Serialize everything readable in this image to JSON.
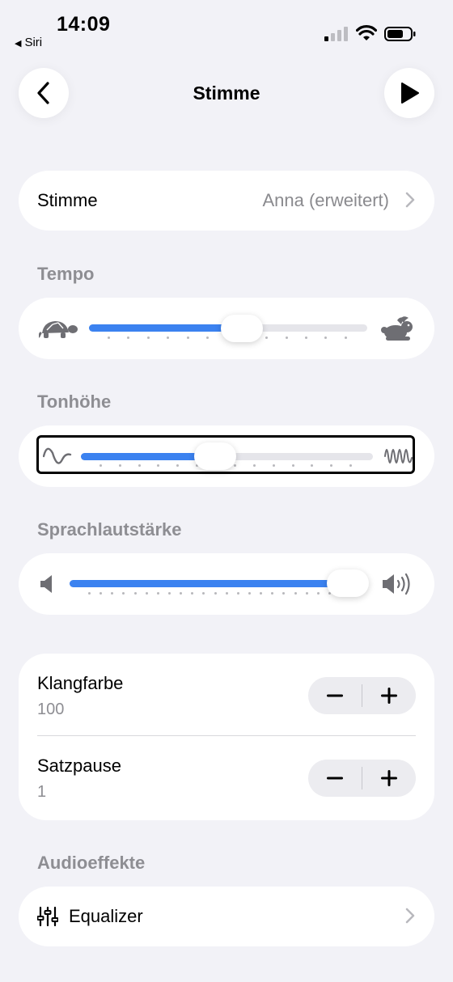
{
  "status": {
    "time": "14:09",
    "back_app": "Siri"
  },
  "nav": {
    "title": "Stimme"
  },
  "voice": {
    "label": "Stimme",
    "value": "Anna (erweitert)"
  },
  "tempo": {
    "section_label": "Tempo",
    "value": 0.55,
    "left_icon": "turtle-icon",
    "right_icon": "rabbit-icon"
  },
  "pitch": {
    "section_label": "Tonhöhe",
    "value": 0.46,
    "left_icon": "low-wave-icon",
    "right_icon": "high-wave-icon"
  },
  "volume": {
    "section_label": "Sprachlautstärke",
    "value": 0.93,
    "left_icon": "speaker-low-icon",
    "right_icon": "speaker-high-icon"
  },
  "timbre": {
    "label": "Klangfarbe",
    "value": "100"
  },
  "sentence_pause": {
    "label": "Satzpause",
    "value": "1"
  },
  "audio_effects": {
    "section_label": "Audioeffekte",
    "equalizer_label": "Equalizer"
  },
  "colors": {
    "accent": "#3b82f0",
    "background": "#f2f2f7",
    "secondary_text": "#8e8e93"
  }
}
